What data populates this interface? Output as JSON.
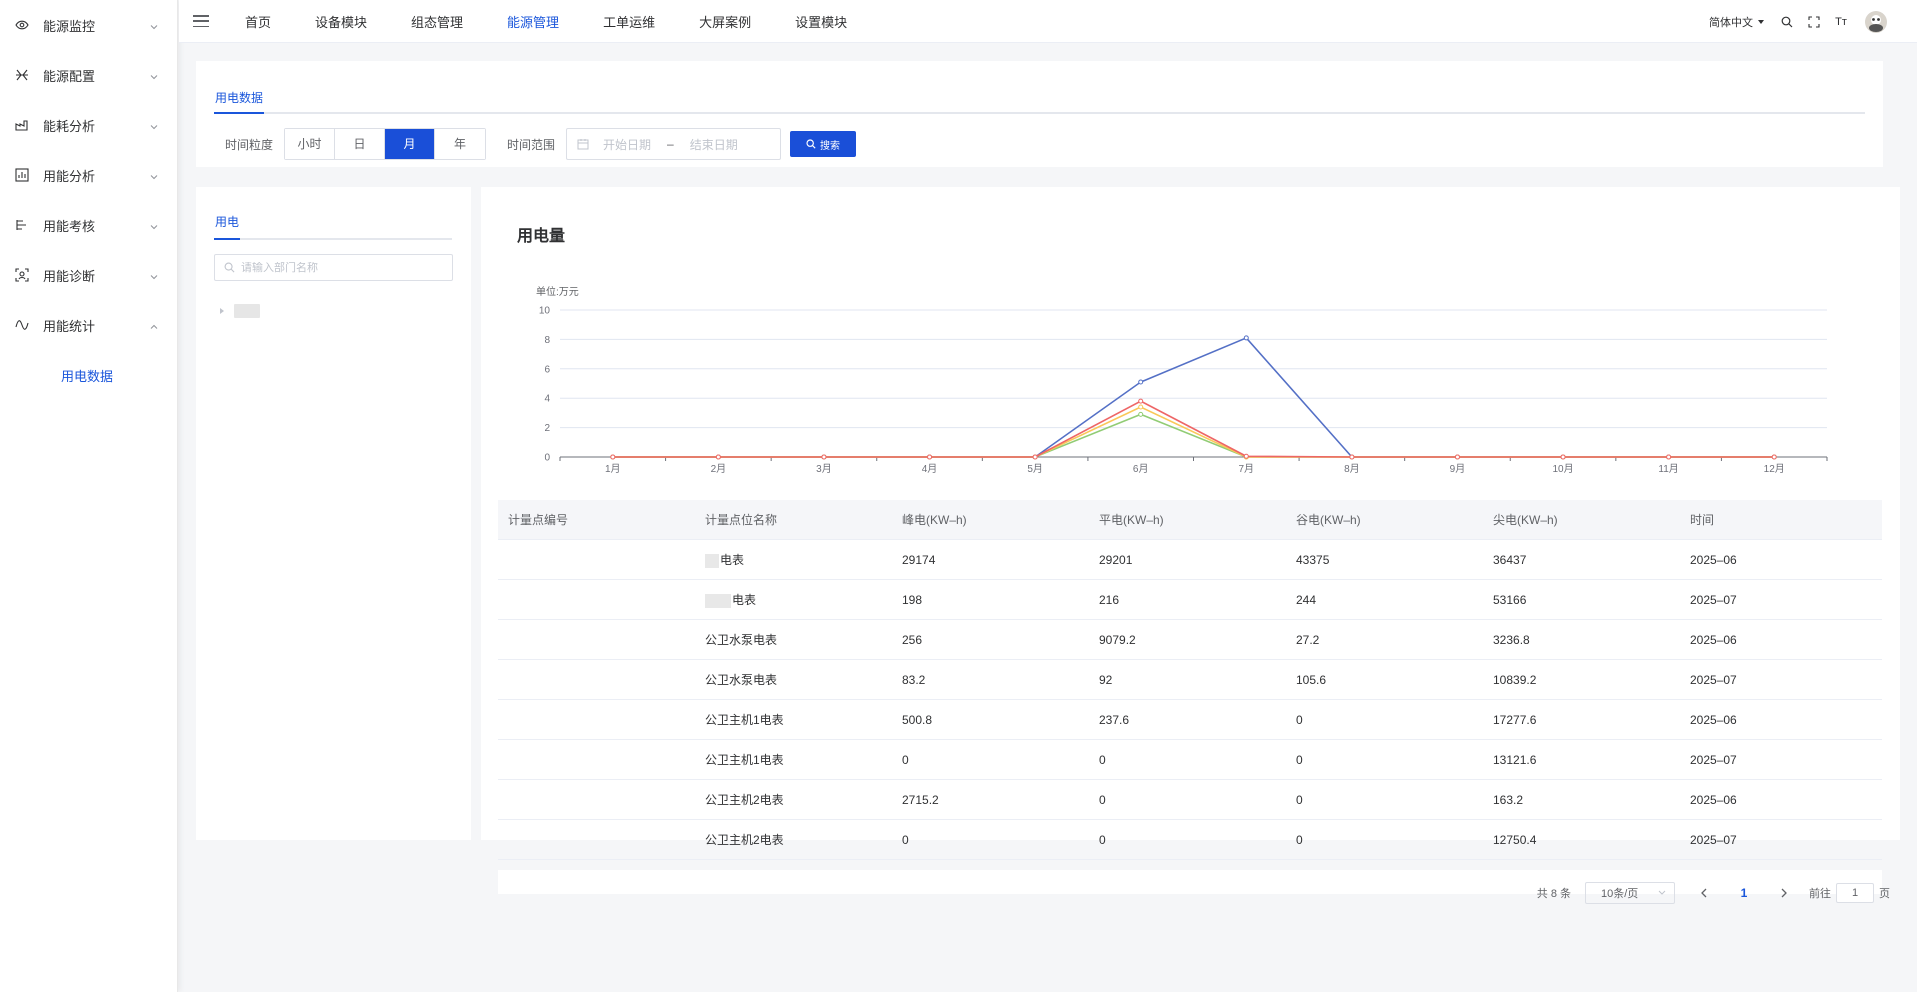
{
  "sidebar": {
    "items": [
      {
        "label": "能源监控",
        "icon": "eye-icon",
        "expanded": false
      },
      {
        "label": "能源配置",
        "icon": "config-icon",
        "expanded": false
      },
      {
        "label": "能耗分析",
        "icon": "factory-icon",
        "expanded": false
      },
      {
        "label": "用能分析",
        "icon": "analysis-icon",
        "expanded": false
      },
      {
        "label": "用能考核",
        "icon": "assessment-icon",
        "expanded": false
      },
      {
        "label": "用能诊断",
        "icon": "diagnosis-icon",
        "expanded": false
      },
      {
        "label": "用能统计",
        "icon": "statistics-icon",
        "expanded": true
      }
    ],
    "sub_item": "用电数据"
  },
  "topbar": {
    "nav": [
      "首页",
      "设备模块",
      "组态管理",
      "能源管理",
      "工单运维",
      "大屏案例",
      "设置模块"
    ],
    "active_nav": "能源管理",
    "language": "简体中文",
    "font_size_icon_label": "Tт"
  },
  "filter": {
    "tab": "用电数据",
    "granularity_label": "时间粒度",
    "granularity_options": [
      "小时",
      "日",
      "月",
      "年"
    ],
    "granularity_selected": "月",
    "range_label": "时间范围",
    "start_placeholder": "开始日期",
    "range_separator": "–",
    "end_placeholder": "结束日期",
    "search_button": "搜索"
  },
  "tree": {
    "tab": "用电",
    "search_placeholder": "请输入部门名称"
  },
  "chart_data": {
    "type": "line",
    "title": "用电量",
    "ylabel": "单位:万元",
    "ylim": [
      0,
      10
    ],
    "yticks": [
      0,
      2,
      4,
      6,
      8,
      10
    ],
    "categories": [
      "1月",
      "2月",
      "3月",
      "4月",
      "5月",
      "6月",
      "7月",
      "8月",
      "9月",
      "10月",
      "11月",
      "12月"
    ],
    "series": [
      {
        "color": "#5470c6",
        "values": [
          0,
          0,
          0,
          0,
          0,
          5.1,
          8.1,
          0,
          0,
          0,
          0,
          0
        ]
      },
      {
        "color": "#91cc75",
        "values": [
          0,
          0,
          0,
          0,
          0,
          2.9,
          0,
          0,
          0,
          0,
          0,
          0
        ]
      },
      {
        "color": "#fac858",
        "values": [
          0,
          0,
          0,
          0,
          0,
          3.4,
          0,
          0,
          0,
          0,
          0,
          0
        ]
      },
      {
        "color": "#ee6666",
        "values": [
          0,
          0,
          0,
          0,
          0,
          3.8,
          0.05,
          0,
          0,
          0,
          0,
          0
        ]
      }
    ],
    "grid": true
  },
  "table": {
    "columns": [
      "计量点编号",
      "计量点位名称",
      "峰电(KW–h)",
      "平电(KW–h)",
      "谷电(KW–h)",
      "尖电(KW–h)",
      "时间"
    ],
    "rows": [
      {
        "code": "",
        "name": "电表",
        "peak": "29174",
        "flat": "29201",
        "valley": "43375",
        "sharp": "36437",
        "time": "2025–06"
      },
      {
        "code": "",
        "name": "电表",
        "peak": "198",
        "flat": "216",
        "valley": "244",
        "sharp": "53166",
        "time": "2025–07"
      },
      {
        "code": "",
        "name": "公卫水泵电表",
        "peak": "256",
        "flat": "9079.2",
        "valley": "27.2",
        "sharp": "3236.8",
        "time": "2025–06"
      },
      {
        "code": "",
        "name": "公卫水泵电表",
        "peak": "83.2",
        "flat": "92",
        "valley": "105.6",
        "sharp": "10839.2",
        "time": "2025–07"
      },
      {
        "code": "",
        "name": "公卫主机1电表",
        "peak": "500.8",
        "flat": "237.6",
        "valley": "0",
        "sharp": "17277.6",
        "time": "2025–06"
      },
      {
        "code": "",
        "name": "公卫主机1电表",
        "peak": "0",
        "flat": "0",
        "valley": "0",
        "sharp": "13121.6",
        "time": "2025–07"
      },
      {
        "code": "",
        "name": "公卫主机2电表",
        "peak": "2715.2",
        "flat": "0",
        "valley": "0",
        "sharp": "163.2",
        "time": "2025–06"
      },
      {
        "code": "",
        "name": "公卫主机2电表",
        "peak": "0",
        "flat": "0",
        "valley": "0",
        "sharp": "12750.4",
        "time": "2025–07"
      }
    ]
  },
  "pagination": {
    "total_text": "共 8 条",
    "page_size": "10条/页",
    "current_page": "1",
    "goto_prefix": "前往",
    "goto_value": "1",
    "goto_suffix": "页"
  }
}
